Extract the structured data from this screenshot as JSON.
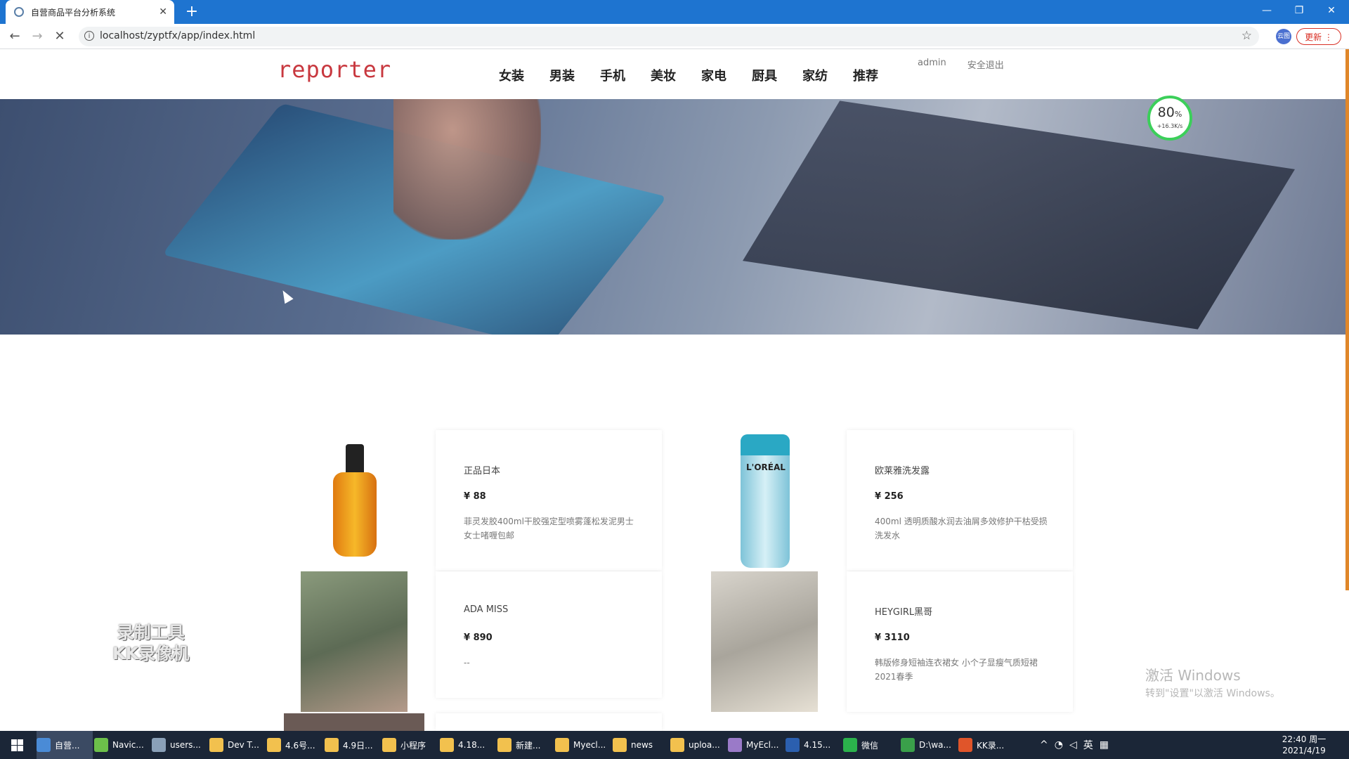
{
  "browser": {
    "tab_title": "自营商品平台分析系统",
    "url": "localhost/zyptfx/app/index.html",
    "new_tab": "+",
    "update_label": "更新",
    "extension_label": "云图"
  },
  "header": {
    "logo": "reporter",
    "nav": [
      "女装",
      "男装",
      "手机",
      "美妆",
      "家电",
      "厨具",
      "家纺",
      "推荐"
    ],
    "user": "admin",
    "logout": "安全退出"
  },
  "speed_widget": {
    "percent": "80",
    "unit": "%",
    "rate": "+16.3K/s"
  },
  "products": [
    {
      "name": "正品日本",
      "price": "¥ 88",
      "desc": "菲灵发胶400ml干胶强定型喷雾蓬松发泥男士女士啫喱包邮"
    },
    {
      "name": "欧莱雅洗发露",
      "price": "¥ 256",
      "desc": "400ml 透明质酸水润去油屑多效修护干枯受损 洗发水",
      "bottle_label": "L'ORÉAL"
    },
    {
      "name": "ADA MISS",
      "price": "¥ 890",
      "desc": "--"
    },
    {
      "name": "HEYGIRL黑哥",
      "price": "¥ 3110",
      "desc": "韩版修身短袖连衣裙女 小个子显瘦气质短裙2021春季"
    }
  ],
  "watermark": {
    "kk_line1": "录制工具",
    "kk_line2": "KK录像机"
  },
  "activation": {
    "line1": "激活 Windows",
    "line2": "转到\"设置\"以激活 Windows。"
  },
  "taskbar": {
    "items": [
      {
        "label": "自营...",
        "color": "#4a8bd6"
      },
      {
        "label": "Navic...",
        "color": "#6cc04a"
      },
      {
        "label": "users...",
        "color": "#8aa0b8"
      },
      {
        "label": "Dev T...",
        "color": "#f2c14e"
      },
      {
        "label": "4.6号...",
        "color": "#f2c14e"
      },
      {
        "label": "4.9日...",
        "color": "#f2c14e"
      },
      {
        "label": "小程序",
        "color": "#f2c14e"
      },
      {
        "label": "4.18...",
        "color": "#f2c14e"
      },
      {
        "label": "新建...",
        "color": "#f2c14e"
      },
      {
        "label": "Myecl...",
        "color": "#f2c14e"
      },
      {
        "label": "news",
        "color": "#f2c14e"
      },
      {
        "label": "uploa...",
        "color": "#f2c14e"
      },
      {
        "label": "MyEcl...",
        "color": "#9a7ac8"
      },
      {
        "label": "4.15...",
        "color": "#2b5faf"
      },
      {
        "label": "微信",
        "color": "#2bb24c"
      },
      {
        "label": "D:\\wa...",
        "color": "#3aa04a"
      },
      {
        "label": "KK录...",
        "color": "#e0552a"
      }
    ],
    "ime": "英",
    "time": "22:40 周一",
    "date": "2021/4/19"
  }
}
